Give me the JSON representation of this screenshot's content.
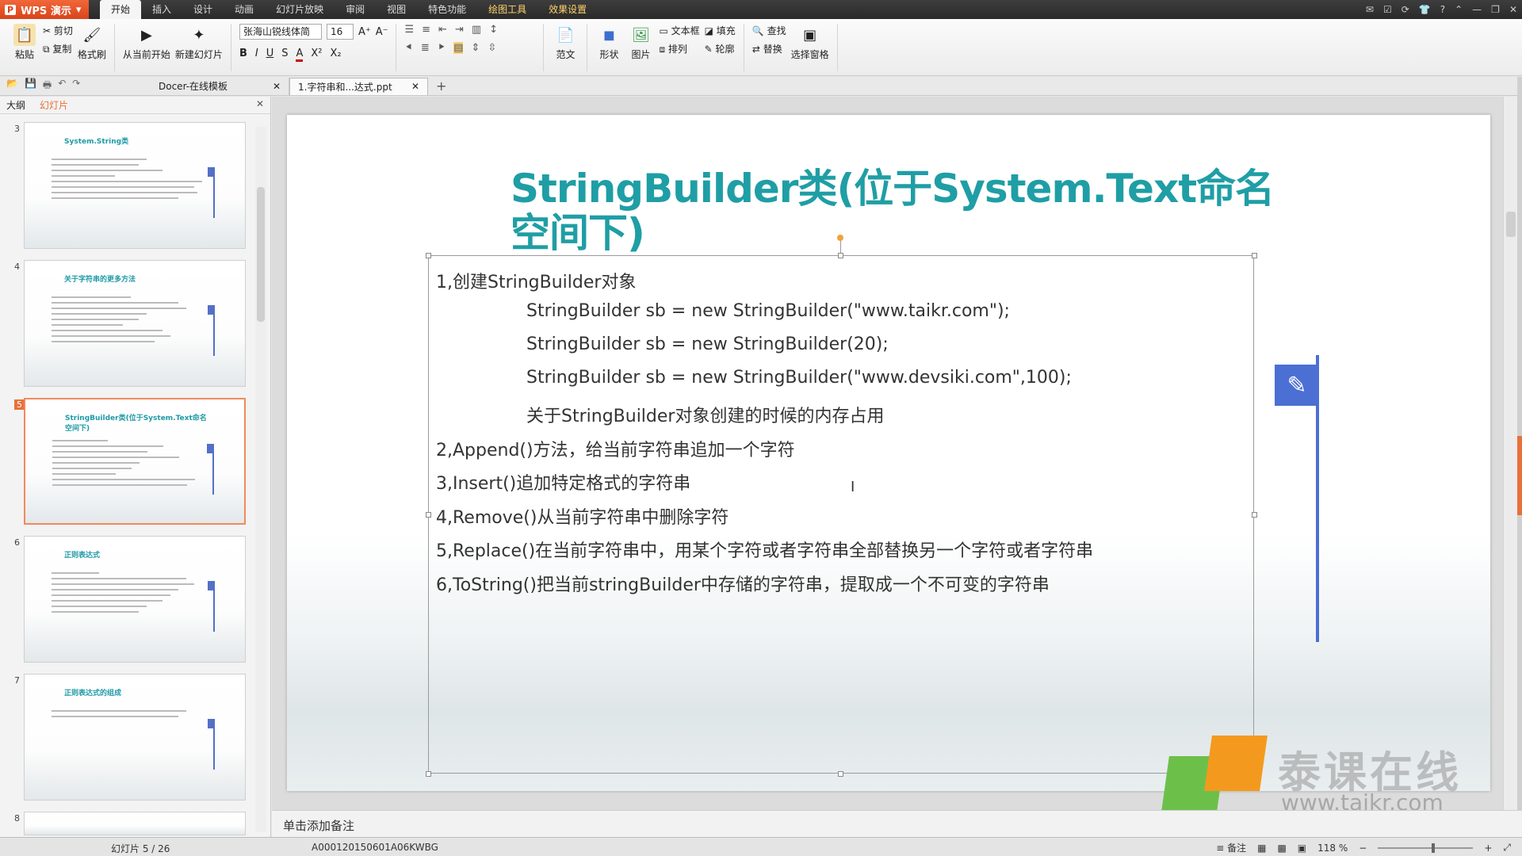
{
  "app": {
    "name": "WPS 演示",
    "logo_letter": "P"
  },
  "menu": [
    "开始",
    "插入",
    "设计",
    "动画",
    "幻灯片放映",
    "审阅",
    "视图",
    "特色功能",
    "绘图工具",
    "效果设置"
  ],
  "ribbon": {
    "paste": "粘贴",
    "cut": "剪切",
    "copy": "复制",
    "format_painter": "格式刷",
    "from_current": "从当前开始",
    "new_slide": "新建幻灯片",
    "font_name": "张海山锐线体简",
    "font_size": "16",
    "bold": "B",
    "italic": "I",
    "underline": "U",
    "shadow": "S",
    "font_color": "A",
    "superscript": "X²",
    "subscript": "X₂",
    "template": "范文",
    "shape": "形状",
    "picture": "图片",
    "textbox": "文本框",
    "arrange": "排列",
    "fill": "填充",
    "outline": "轮廓",
    "find": "查找",
    "replace": "替换",
    "selection_pane": "选择窗格"
  },
  "tabs": [
    {
      "label": "Docer-在线模板",
      "active": false
    },
    {
      "label": "1.字符串和...达式.ppt",
      "active": true
    }
  ],
  "left_pane": {
    "outline_tab": "大纲",
    "slides_tab": "幻灯片"
  },
  "thumbnails": [
    {
      "num": "3",
      "title": "System.String类"
    },
    {
      "num": "4",
      "title": "关于字符串的更多方法"
    },
    {
      "num": "5",
      "title": "StringBuilder类(位于System.Text命名空间下)"
    },
    {
      "num": "6",
      "title": "正则表达式"
    },
    {
      "num": "7",
      "title": "正则表达式的组成"
    },
    {
      "num": "8",
      "title": ""
    }
  ],
  "slide": {
    "title": "StringBuilder类(位于System.Text命名空间下)",
    "lines": [
      "1,创建StringBuilder对象",
      "StringBuilder sb = new StringBuilder(\"www.taikr.com\");",
      "StringBuilder sb = new StringBuilder(20);",
      "StringBuilder sb = new StringBuilder(\"www.devsiki.com\",100);",
      "关于StringBuilder对象创建的时候的内存占用",
      "2,Append()方法，给当前字符串追加一个字符",
      "3,Insert()追加特定格式的字符串",
      "4,Remove()从当前字符串中删除字符",
      "5,Replace()在当前字符串中，用某个字符或者字符串全部替换另一个字符或者字符串",
      "6,ToString()把当前stringBuilder中存储的字符串，提取成一个不可变的字符串"
    ]
  },
  "notes_placeholder": "单击添加备注",
  "status": {
    "slide_counter": "幻灯片 5 / 26",
    "doc_id": "A000120150601A06KWBG",
    "notes_btn": "备注",
    "zoom": "118 %"
  },
  "watermark": {
    "brand": "泰课在线",
    "url": "www.taikr.com"
  }
}
